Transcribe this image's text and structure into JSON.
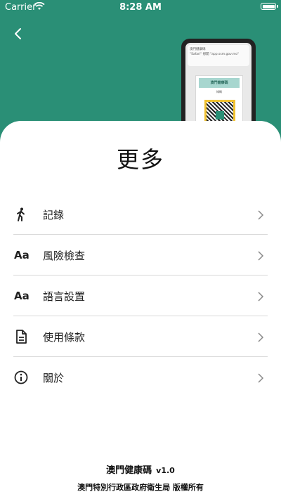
{
  "status_bar": {
    "carrier": "Carrier",
    "time": "8:28 AM"
  },
  "page": {
    "title": "更多"
  },
  "phone_preview": {
    "notification_title": "澳門健康碼",
    "notification_text": "\"Safari\" 想開 \"app.ssm.gov.mo\"",
    "card_title": "澳門健康碼",
    "card_subtitle": "綠碼",
    "qr_color": "#2a8f76"
  },
  "menu": [
    {
      "label": "記錄",
      "icon": "walking-person-icon"
    },
    {
      "label": "風險檢查",
      "icon": "text-size-icon",
      "icon_text": "Aa"
    },
    {
      "label": "語言設置",
      "icon": "text-size-icon",
      "icon_text": "Aa"
    },
    {
      "label": "使用條款",
      "icon": "document-icon"
    },
    {
      "label": "關於",
      "icon": "info-icon"
    }
  ],
  "footer": {
    "app_name": "澳門健康碼",
    "version": "v1.0",
    "copyright": "澳門特別行政區政府衛生局 版權所有"
  },
  "colors": {
    "header": "#2a8f76",
    "sheet": "#ffffff",
    "text": "#222222"
  }
}
